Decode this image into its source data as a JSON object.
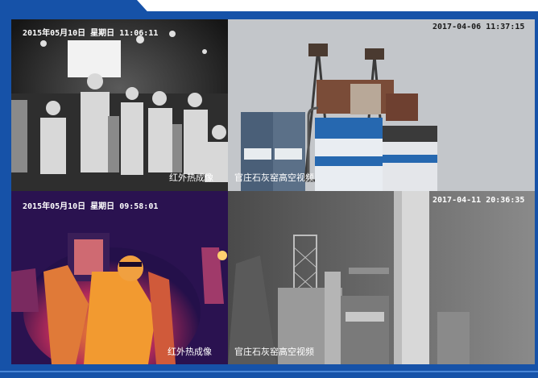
{
  "panels": {
    "thermal_bw": {
      "timestamp": "2015年05月10日  星期日  11:06:11",
      "caption": "红外热成像"
    },
    "lime_kiln_day": {
      "timestamp": "2017-04-06  11:37:15",
      "caption": "官庄石灰窑高空视频"
    },
    "thermal_color": {
      "timestamp": "2015年05月10日  星期日  09:58:01",
      "caption": "红外热成像"
    },
    "lime_kiln_night": {
      "timestamp": "2017-04-11  20:36:35",
      "caption": "官庄石灰窑高空视频"
    }
  },
  "colors": {
    "brand_blue": "#1652a8",
    "accent_blue": "#4a86d6"
  }
}
